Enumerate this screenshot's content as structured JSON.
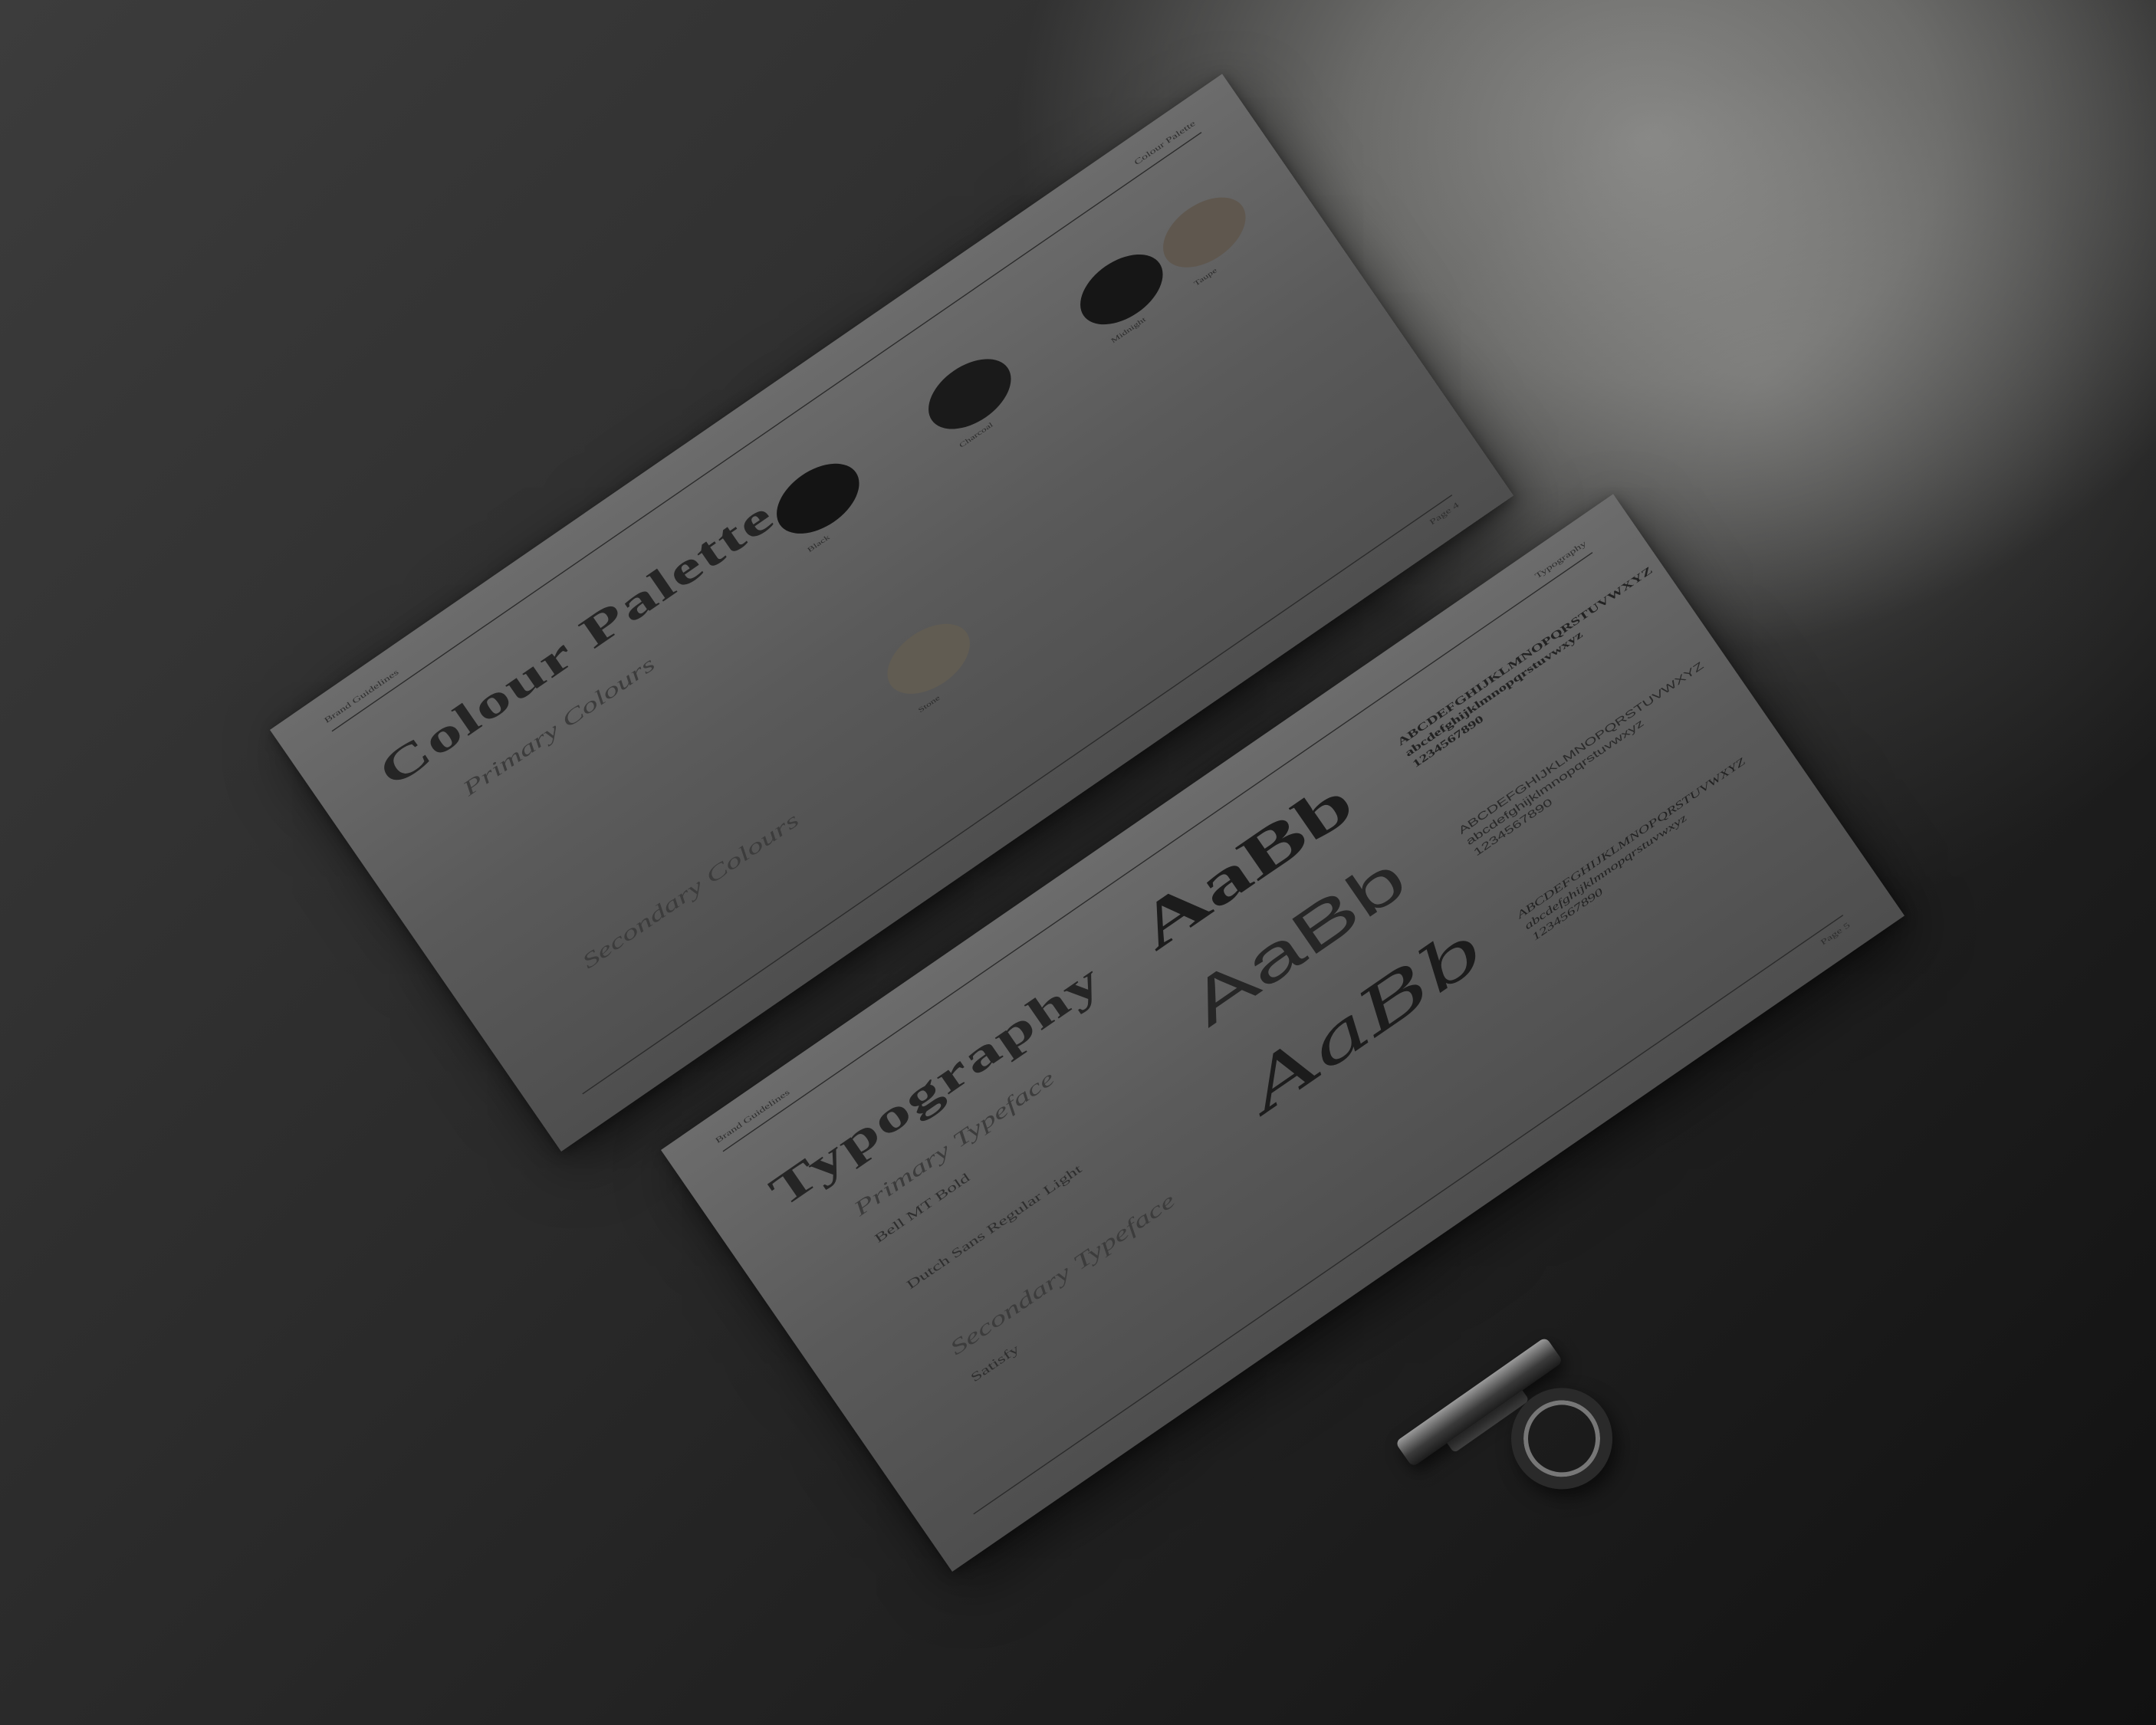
{
  "colour_sheet": {
    "header_right": "Colour Palette",
    "header_left": "Brand Guidelines",
    "title": "Colour Palette",
    "primary_heading": "Primary Colours",
    "secondary_heading": "Secondary Colours",
    "page_number": "Page 4",
    "swatches": [
      {
        "name": "Black",
        "color": "#141414"
      },
      {
        "name": "Charcoal",
        "color": "#1a1a1a"
      },
      {
        "name": "Midnight",
        "color": "#161616"
      },
      {
        "name": "Taupe",
        "color": "#5f574e"
      },
      {
        "name": "Stone",
        "color": "#615c52"
      }
    ]
  },
  "type_sheet": {
    "header_right": "Typography",
    "header_left": "Brand Guidelines",
    "title": "Typography",
    "primary_heading": "Primary Typeface",
    "font_one": "Bell MT Bold",
    "font_two": "Dutch Sans Regular Light",
    "secondary_heading": "Secondary Typeface",
    "font_three": "Satisfy",
    "page_number": "Page 5",
    "sample_glyphs": "AaBb",
    "alphabet_upper": "ABCDEFGHIJKLMNOPQRSTUVWXYZ",
    "alphabet_lower": "abcdefghijklmnopqrstuvwxyz",
    "digits": "1234567890"
  }
}
